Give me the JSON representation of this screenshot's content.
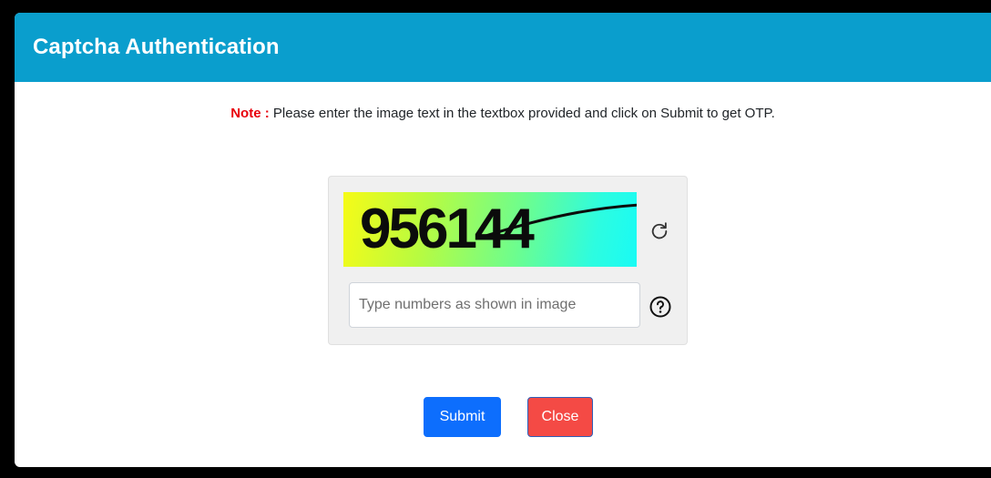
{
  "modal": {
    "title": "Captcha Authentication",
    "header_color": "#0a9ecd"
  },
  "note": {
    "label": "Note :",
    "text": " Please enter the image text in the textbox provided and click on Submit to get OTP."
  },
  "captcha": {
    "image_text": "956144",
    "refresh_icon": "refresh-icon",
    "input_placeholder": "Type numbers as shown in image",
    "input_value": "",
    "help_icon": "question-circle-icon"
  },
  "actions": {
    "submit_label": "Submit",
    "close_label": "Close",
    "submit_color": "#0d6efd",
    "close_color": "#f44a45"
  }
}
